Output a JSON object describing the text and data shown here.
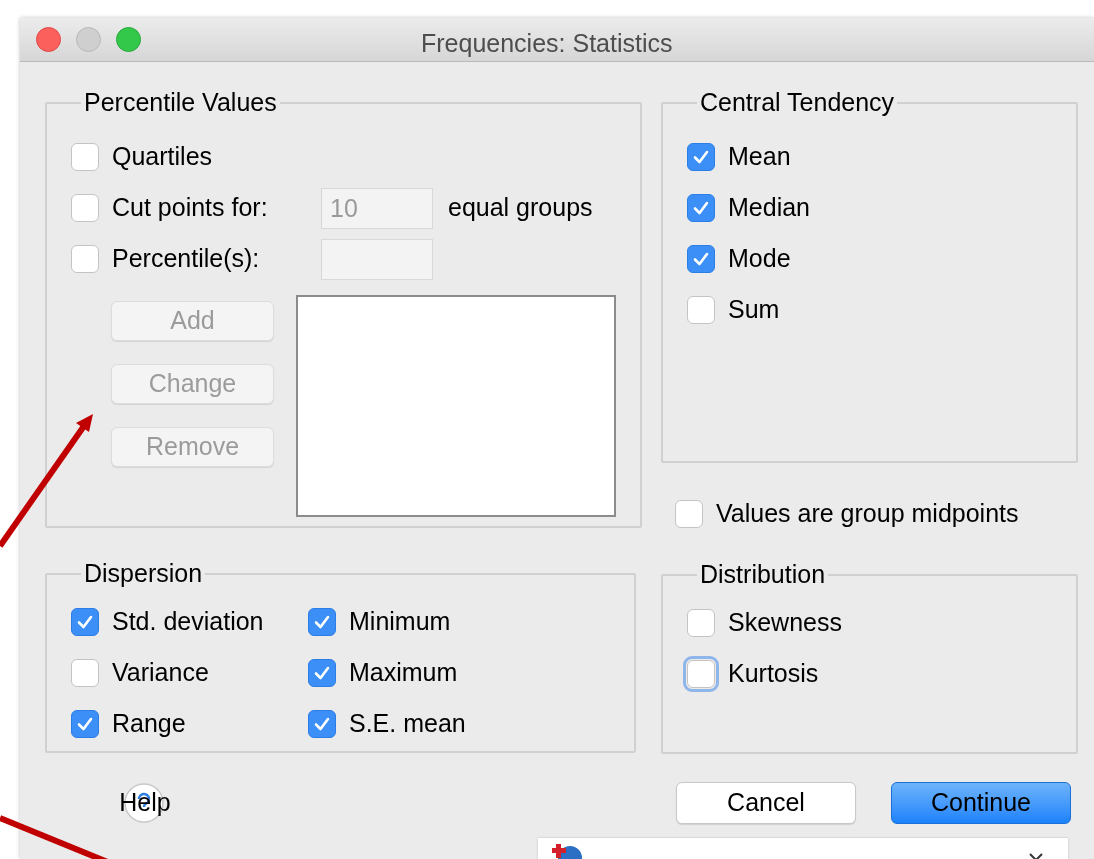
{
  "window": {
    "title": "Frequencies: Statistics"
  },
  "percentile_values": {
    "title": "Percentile Values",
    "rows": [
      {
        "kind": "plain",
        "label": "Quartiles",
        "checked": false
      },
      {
        "kind": "count_field",
        "label": "Cut points for:",
        "checked": false,
        "value": "10",
        "suffix": "equal groups",
        "disabled": true
      },
      {
        "kind": "list_field",
        "label": "Percentile(s):",
        "checked": false,
        "disabled": true
      }
    ],
    "buttons": [
      {
        "label": "Add",
        "disabled": true
      },
      {
        "label": "Change",
        "disabled": true
      },
      {
        "label": "Remove",
        "disabled": true
      }
    ]
  },
  "central_tendency": {
    "title": "Central Tendency",
    "items": [
      {
        "label": "Mean",
        "checked": true
      },
      {
        "label": "Median",
        "checked": true
      },
      {
        "label": "Mode",
        "checked": true
      },
      {
        "label": "Sum",
        "checked": false
      }
    ]
  },
  "group_midpoints": {
    "label": "Values are group midpoints",
    "checked": false
  },
  "dispersion": {
    "title": "Dispersion",
    "items": [
      {
        "label": "Std. deviation",
        "checked": true
      },
      {
        "label": "Minimum",
        "checked": true
      },
      {
        "label": "Variance",
        "checked": false
      },
      {
        "label": "Maximum",
        "checked": true
      },
      {
        "label": "Range",
        "checked": true
      },
      {
        "label": "S.E. mean",
        "checked": true
      }
    ]
  },
  "distribution": {
    "title": "Distribution",
    "items": [
      {
        "label": "Skewness",
        "checked": false,
        "focused": false
      },
      {
        "label": "Kurtosis",
        "checked": false,
        "focused": true
      }
    ]
  },
  "footer": {
    "buttons": [
      {
        "kind": "help",
        "label": "Help"
      },
      {
        "kind": "normal",
        "label": "Cancel"
      },
      {
        "kind": "default",
        "label": "Continue"
      }
    ]
  }
}
